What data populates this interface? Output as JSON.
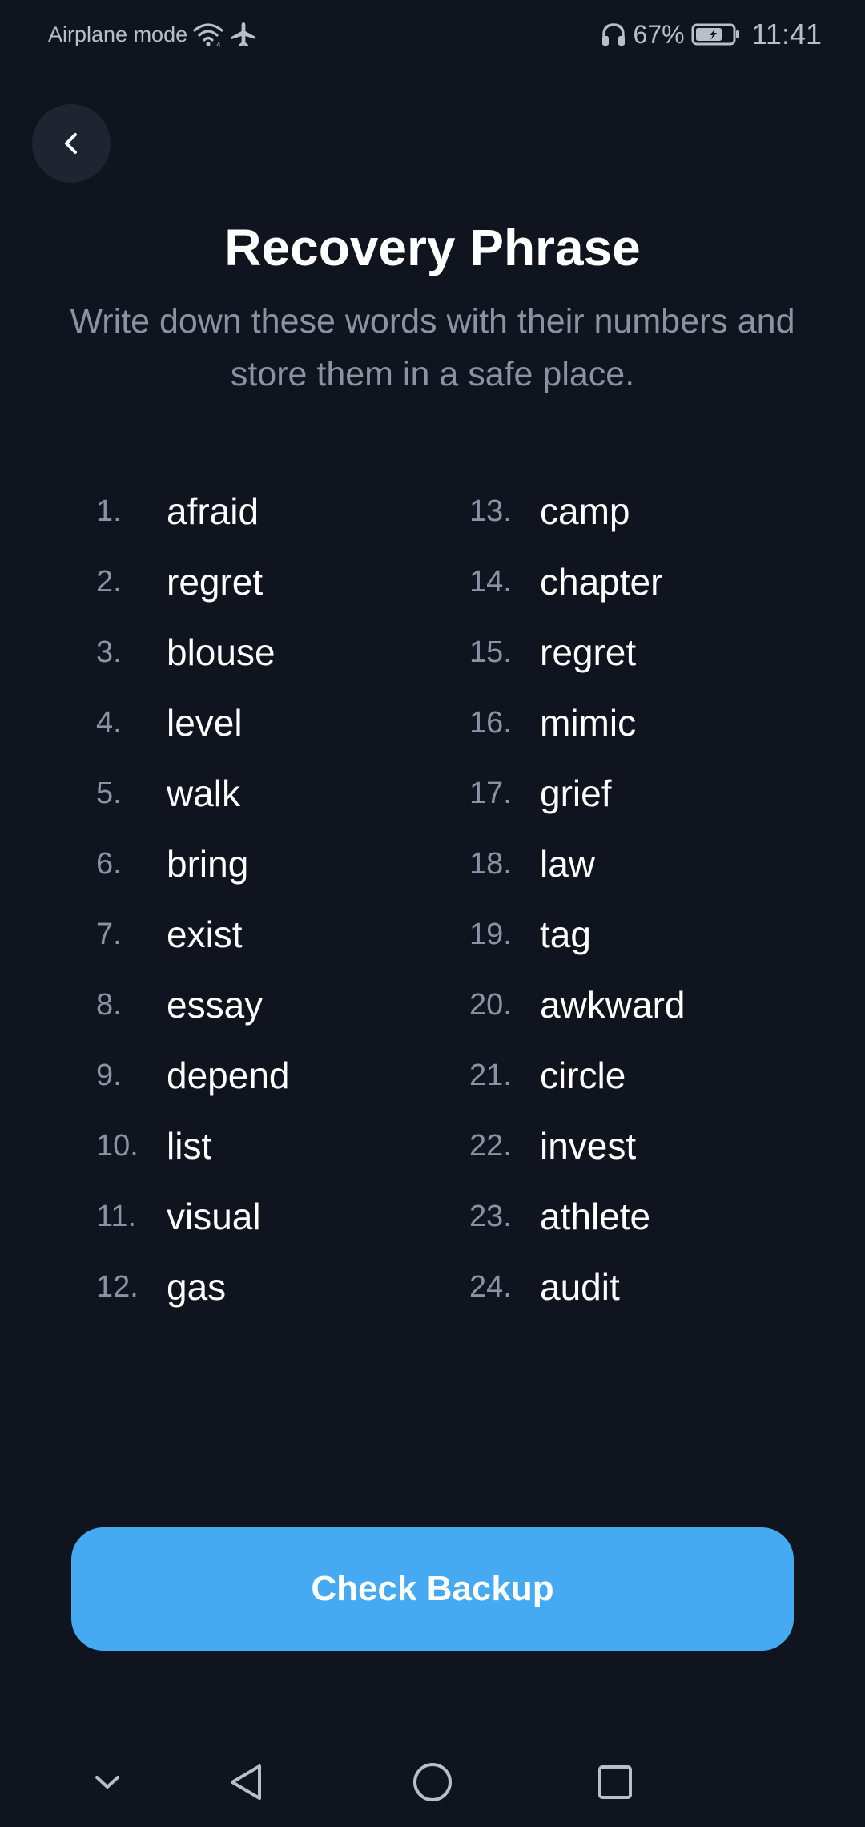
{
  "status_bar": {
    "mode_label": "Airplane mode",
    "battery_percent": "67%",
    "time": "11:41",
    "icons": [
      "wifi-icon",
      "airplane-icon",
      "headphones-icon",
      "battery-icon"
    ]
  },
  "header": {
    "back_icon": "chevron-left-icon",
    "title": "Recovery Phrase",
    "subtitle": "Write down these words with their numbers and store them in a safe place."
  },
  "phrase": {
    "left": [
      {
        "num": "1.",
        "word": "afraid"
      },
      {
        "num": "2.",
        "word": "regret"
      },
      {
        "num": "3.",
        "word": "blouse"
      },
      {
        "num": "4.",
        "word": "level"
      },
      {
        "num": "5.",
        "word": "walk"
      },
      {
        "num": "6.",
        "word": "bring"
      },
      {
        "num": "7.",
        "word": "exist"
      },
      {
        "num": "8.",
        "word": "essay"
      },
      {
        "num": "9.",
        "word": "depend"
      },
      {
        "num": "10.",
        "word": "list"
      },
      {
        "num": "11.",
        "word": "visual"
      },
      {
        "num": "12.",
        "word": "gas"
      }
    ],
    "right": [
      {
        "num": "13.",
        "word": "camp"
      },
      {
        "num": "14.",
        "word": "chapter"
      },
      {
        "num": "15.",
        "word": "regret"
      },
      {
        "num": "16.",
        "word": "mimic"
      },
      {
        "num": "17.",
        "word": "grief"
      },
      {
        "num": "18.",
        "word": "law"
      },
      {
        "num": "19.",
        "word": "tag"
      },
      {
        "num": "20.",
        "word": "awkward"
      },
      {
        "num": "21.",
        "word": "circle"
      },
      {
        "num": "22.",
        "word": "invest"
      },
      {
        "num": "23.",
        "word": "athlete"
      },
      {
        "num": "24.",
        "word": "audit"
      }
    ]
  },
  "cta": {
    "label": "Check Backup",
    "color": "#45aaf2"
  },
  "navbar": {
    "icons": [
      "chevron-down-icon",
      "back-triangle-icon",
      "home-circle-icon",
      "recents-square-icon"
    ]
  },
  "colors": {
    "background": "#10141e",
    "muted_text": "#8a93a2",
    "back_button_bg": "#1f2530"
  }
}
